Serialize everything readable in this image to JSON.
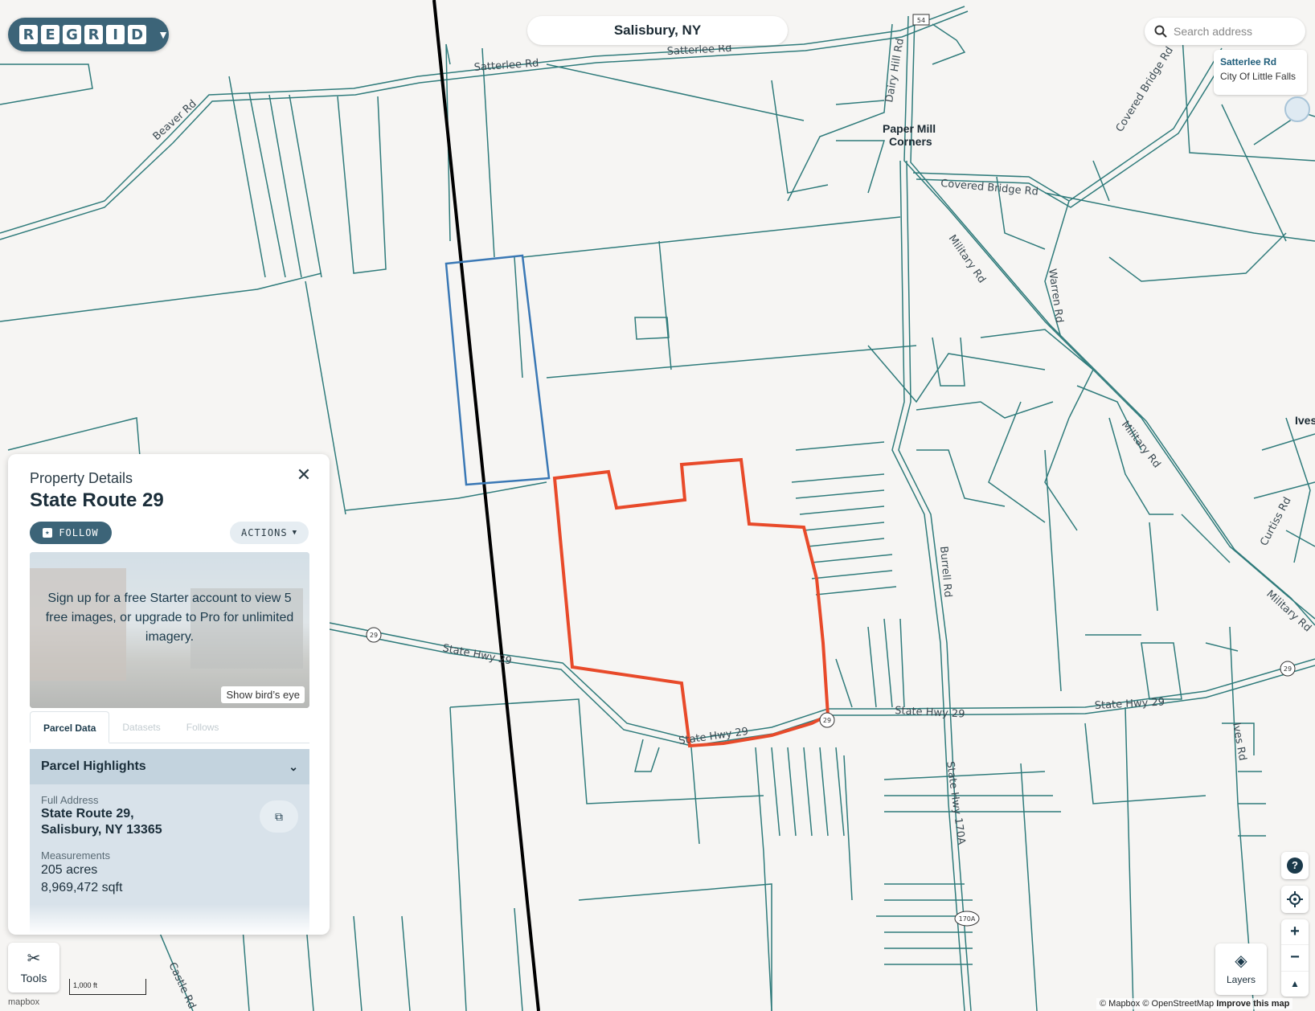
{
  "app": {
    "logo_letters": [
      "R",
      "E",
      "G",
      "R",
      "I",
      "D"
    ],
    "logo_menu_icon": "chevron-down-icon"
  },
  "location": {
    "title": "Salisbury, NY"
  },
  "search": {
    "placeholder": "Search address",
    "icon": "search-icon"
  },
  "result": {
    "street": "Satterlee Rd",
    "locality": "City Of Little Falls"
  },
  "map": {
    "road_labels": [
      "Satterlee Rd",
      "Satterlee Rd",
      "Beaver Rd",
      "Dairy Hill Rd",
      "Covered Bridge Rd",
      "Covered Bridge Rd",
      "Military Rd",
      "Warren Rd",
      "Military Rd",
      "Burrell Rd",
      "State Hwy 29",
      "State Hwy 29",
      "State Hwy 29",
      "State Hwy 29",
      "State Hwy 170A",
      "Ives Rd",
      "Castle Rd",
      "Curtiss Rd",
      "Military Rd"
    ],
    "place_labels": [
      "Paper Mill",
      "Corners",
      "Ives"
    ],
    "route_shields": [
      "29",
      "29",
      "29",
      "170A",
      "54"
    ],
    "colors": {
      "parcel_lines": "#2f7b7b",
      "selected_parcel": "#e84a2a",
      "adjacent_parcel": "#3a78b5",
      "boundary": "#000000",
      "road": "#ffffff",
      "background": "#f6f5f3"
    }
  },
  "panel": {
    "subtitle": "Property Details",
    "title": "State Route 29",
    "close_icon": "close-icon",
    "follow_label": "FOLLOW",
    "actions_label": "ACTIONS",
    "imagery_message": "Sign up for a free Starter account to view 5 free images, or upgrade to Pro for unlimited imagery.",
    "birds_eye_label": "Show bird’s eye",
    "tabs": [
      "Parcel Data",
      "Datasets",
      "Follows"
    ],
    "active_tab": "Parcel Data",
    "highlights": {
      "heading": "Parcel Highlights",
      "full_address_label": "Full Address",
      "address_line1": "State Route 29,",
      "address_line2": "Salisbury, NY 13365",
      "measurements_label": "Measurements",
      "acres": "205 acres",
      "sqft": "8,969,472 sqft"
    }
  },
  "tools": {
    "label": "Tools",
    "icon": "tools-icon"
  },
  "scale": {
    "label": "1,000 ft"
  },
  "controls": {
    "help_label": "?",
    "zoom_in": "+",
    "zoom_out": "−",
    "compass": "▲"
  },
  "layers": {
    "label": "Layers",
    "icon": "layers-icon"
  },
  "attribution": {
    "mapbox": "© Mapbox",
    "osm": "© OpenStreetMap",
    "improve": "Improve this map",
    "mapbox_logo": "mapbox"
  }
}
